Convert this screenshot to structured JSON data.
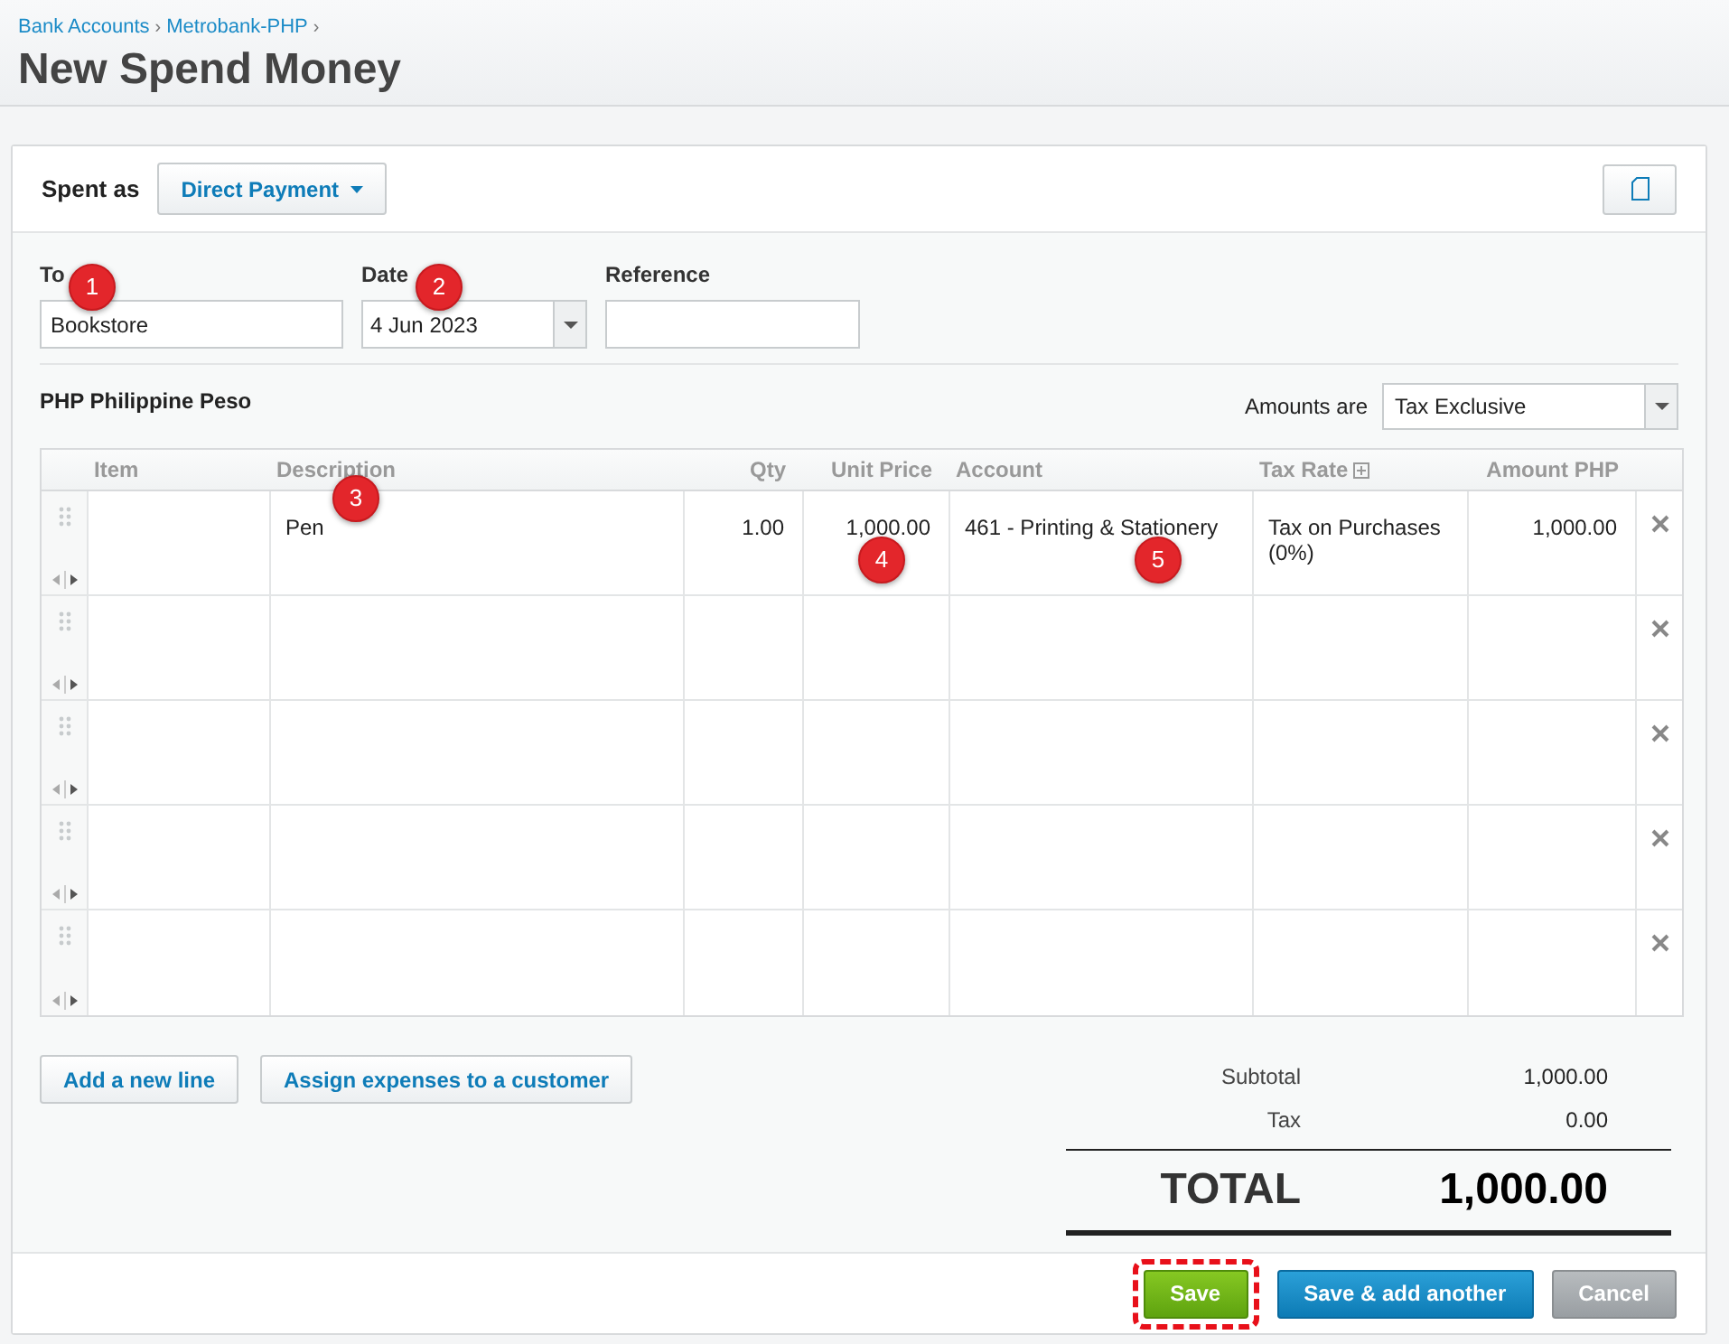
{
  "breadcrumb": [
    "Bank Accounts",
    "Metrobank-PHP"
  ],
  "breadcrumb_separator": "›",
  "title": "New Spend Money",
  "spent_as": {
    "label": "Spent as",
    "value": "Direct Payment"
  },
  "fields": [
    {
      "label": "To",
      "value": "Bookstore",
      "kind": "text"
    },
    {
      "label": "Date",
      "value": "4 Jun 2023",
      "kind": "dropdown"
    },
    {
      "label": "Reference",
      "kind": "text"
    }
  ],
  "currency": "PHP Philippine Peso",
  "amounts_are": {
    "label": "Amounts are",
    "value": "Tax Exclusive"
  },
  "table": {
    "columns": [
      "Item",
      "Description",
      "Qty",
      "Unit Price",
      "Account",
      "Tax Rate",
      "Amount PHP"
    ],
    "rows": [
      {
        "kind": "filled",
        "description": "Pen",
        "qty": "1.00",
        "unit_price": "1,000.00",
        "account": "461 - Printing & Stationery",
        "tax_rate": "Tax on Purchases (0%)",
        "amount": "1,000.00"
      },
      {
        "kind": "blank"
      },
      {
        "kind": "blank"
      },
      {
        "kind": "blank"
      },
      {
        "kind": "blank"
      }
    ]
  },
  "line_buttons": [
    "Add a new line",
    "Assign expenses to a customer"
  ],
  "totals": {
    "subtotal_label": "Subtotal",
    "subtotal": "1,000.00",
    "tax_label": "Tax",
    "tax": "0.00",
    "total_label": "TOTAL",
    "total": "1,000.00"
  },
  "actions": [
    {
      "label": "Save",
      "kind": "primary",
      "highlighted": true
    },
    {
      "label": "Save & add another",
      "kind": "secondary",
      "highlighted": false
    },
    {
      "label": "Cancel",
      "kind": "cancel",
      "highlighted": false
    }
  ],
  "callouts": [
    "1",
    "2",
    "3",
    "4",
    "5"
  ]
}
